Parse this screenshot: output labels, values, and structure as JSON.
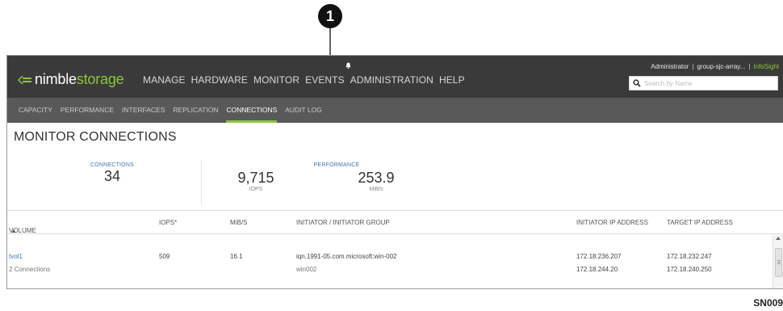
{
  "callout": {
    "number": "1"
  },
  "header": {
    "logo": {
      "prefix": "nimble",
      "suffix": "storage"
    },
    "nav": [
      "MANAGE",
      "HARDWARE",
      "MONITOR",
      "EVENTS",
      "ADMINISTRATION",
      "HELP"
    ],
    "user": "Administrator",
    "group": "group-sjc-array...",
    "infosight": "InfoSight",
    "search_placeholder": "Search by Name"
  },
  "subnav": {
    "tabs": [
      "CAPACITY",
      "PERFORMANCE",
      "INTERFACES",
      "REPLICATION",
      "CONNECTIONS",
      "AUDIT LOG"
    ],
    "active": "CONNECTIONS"
  },
  "page": {
    "title": "MONITOR CONNECTIONS"
  },
  "stats": {
    "connections_label": "CONNECTIONS",
    "connections_value": "34",
    "performance_label": "PERFORMANCE",
    "iops_value": "9,715",
    "iops_unit": "IOPS",
    "mibs_value": "253.9",
    "mibs_unit": "MiB/s"
  },
  "table": {
    "columns": {
      "volume": "VOLUME",
      "iops": "IOPS*",
      "mibs": "MiB/S",
      "initiator": "INITIATOR / INITIATOR GROUP",
      "initiator_ip": "INITIATOR IP ADDRESS",
      "target_ip": "TARGET IP ADDRESS"
    },
    "rows": [
      {
        "volume": "tvol1",
        "connections": "2 Connections",
        "iops": "509",
        "mibs": "16.1",
        "initiator": "iqn.1991-05.com.microsoft:win-002",
        "initiator_group": "win002",
        "initiator_ips": [
          "172.18.236.207",
          "172.18.244.20"
        ],
        "target_ips": [
          "172.18.232.247",
          "172.18.240.250"
        ]
      }
    ]
  },
  "figure_code": "SN009"
}
